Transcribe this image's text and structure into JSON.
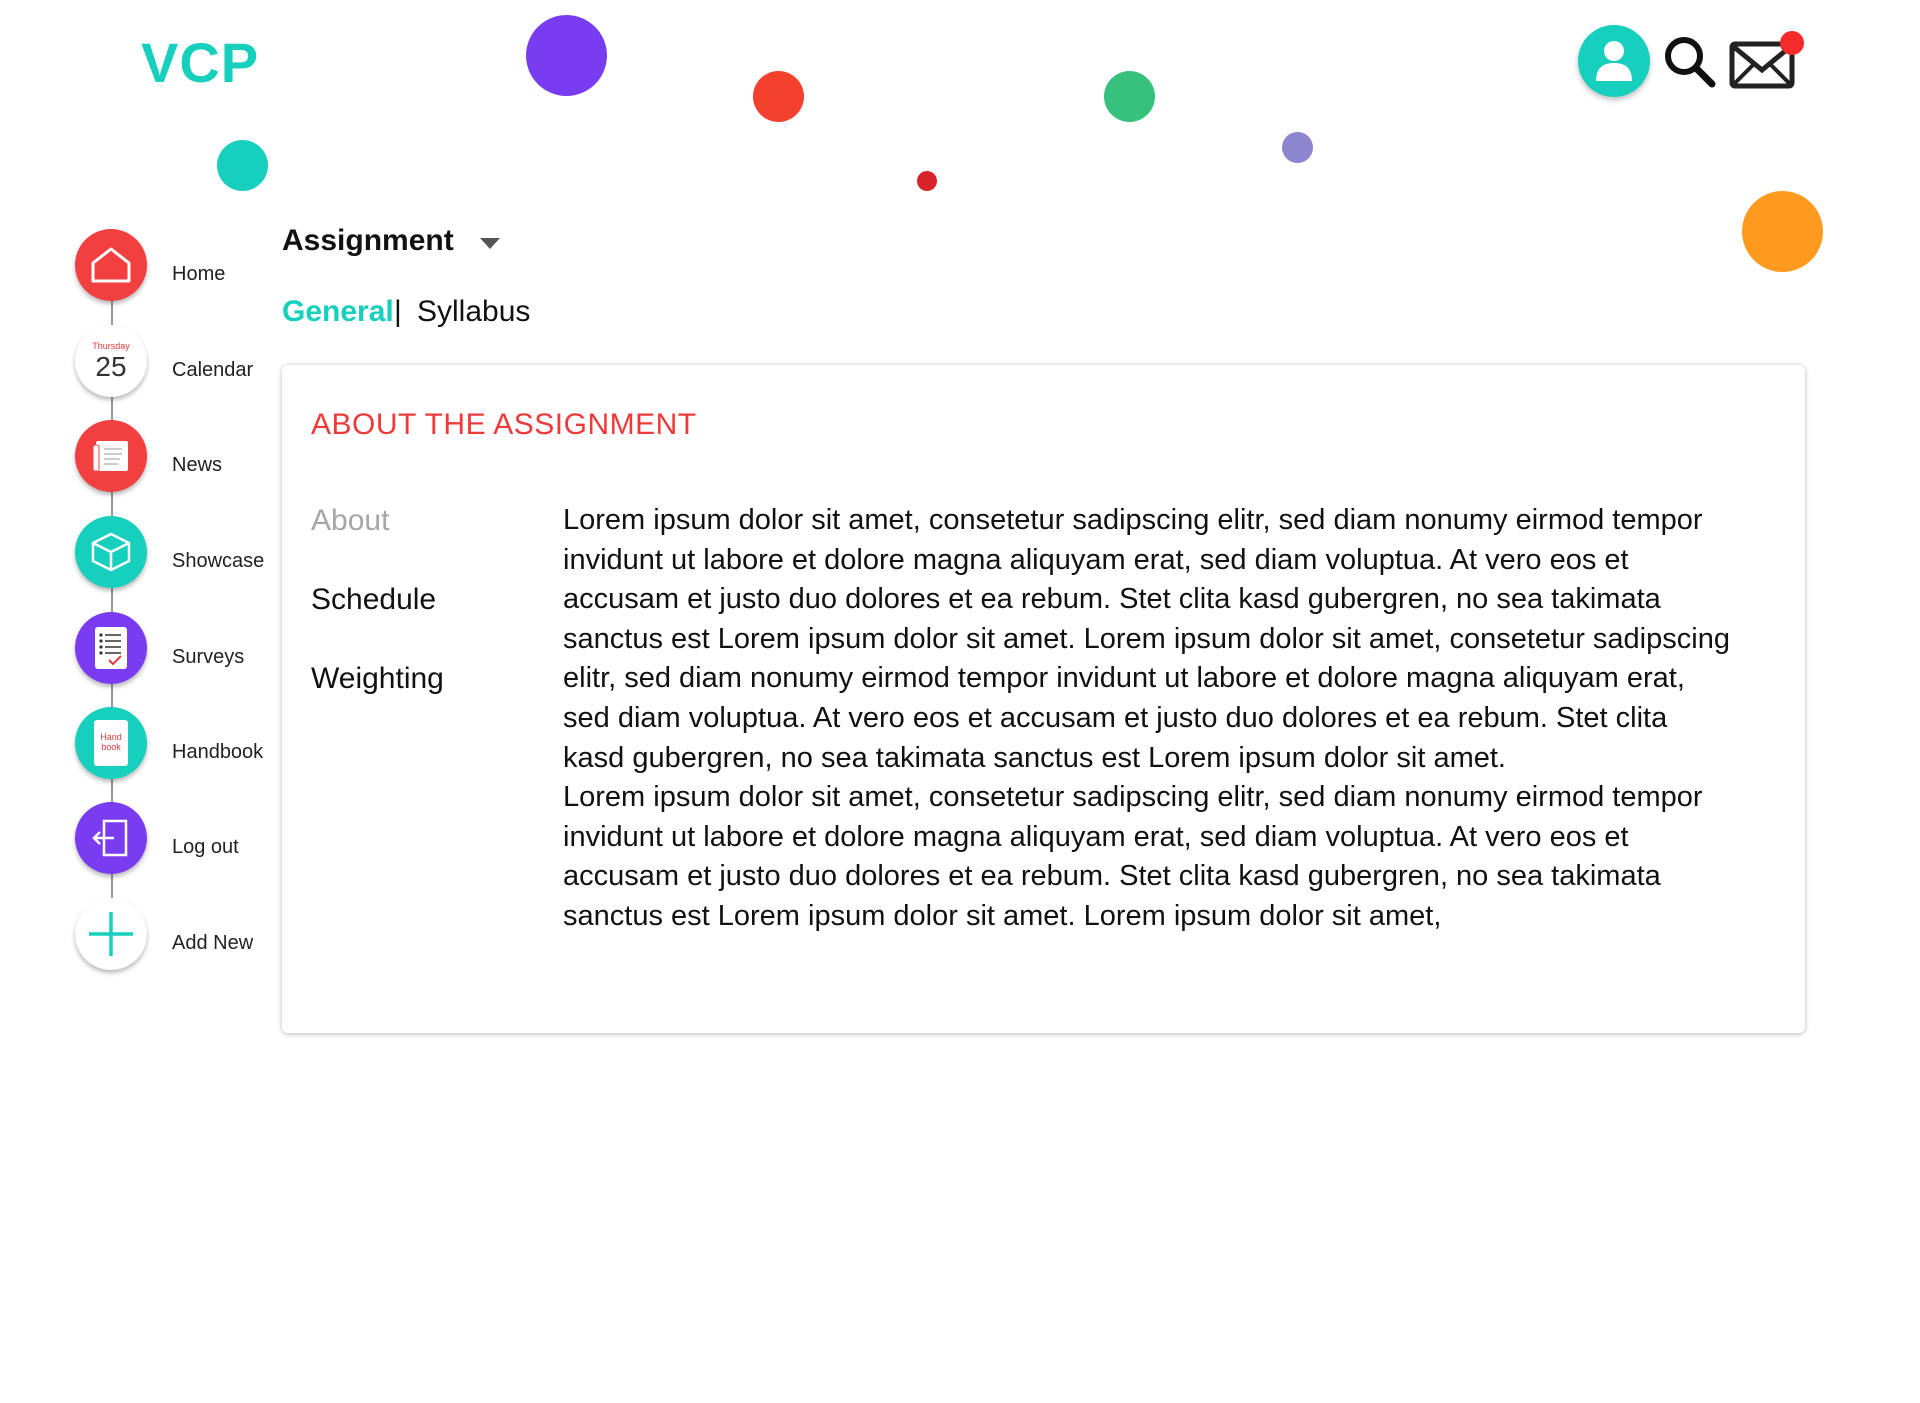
{
  "brand": {
    "logo_text": "VCP"
  },
  "header": {
    "profile_icon": "user-icon",
    "search_icon": "search-icon",
    "mail_icon": "mail-icon",
    "mail_has_notification": true
  },
  "colors": {
    "teal": "#16cfbd",
    "red": "#f24040",
    "purple": "#7a3cf0",
    "orange": "#ff9a1f",
    "green": "#36c17c",
    "lavender": "#8d86cf"
  },
  "sidebar": {
    "items": [
      {
        "label": "Home",
        "icon": "home-icon"
      },
      {
        "label": "Calendar",
        "icon": "calendar-icon",
        "day_name": "Thursday",
        "day_number": "25"
      },
      {
        "label": "News",
        "icon": "news-icon"
      },
      {
        "label": "Showcase",
        "icon": "box-icon"
      },
      {
        "label": "Surveys",
        "icon": "survey-icon"
      },
      {
        "label": "Handbook",
        "icon": "handbook-icon",
        "icon_text_1": "Hand",
        "icon_text_2": "book"
      },
      {
        "label": "Log out",
        "icon": "logout-icon"
      },
      {
        "label": "Add New",
        "icon": "plus-icon"
      }
    ]
  },
  "main": {
    "title": "Assignment",
    "tabs": [
      {
        "label": "General",
        "active": true
      },
      {
        "label": "Syllabus",
        "active": false
      }
    ],
    "tab_separator": "|",
    "card": {
      "title": "ABOUT THE ASSIGNMENT",
      "side_nav": [
        "About",
        "Schedule",
        "Weighting"
      ],
      "paragraphs": [
        "Lorem ipsum dolor sit amet, consetetur sadipscing elitr, sed diam nonumy eirmod tempor invidunt ut labore et dolore magna aliquyam erat, sed diam voluptua. At vero eos et accusam et justo duo dolores et ea rebum. Stet clita kasd gubergren, no sea takimata sanctus est Lorem ipsum dolor sit amet. Lorem ipsum dolor sit amet, consetetur sadipscing elitr, sed diam nonumy eirmod tempor invidunt ut labore et dolore magna aliquyam erat, sed diam voluptua. At vero eos et accusam et justo duo dolores et ea rebum. Stet clita kasd gubergren, no sea takimata sanctus est Lorem ipsum dolor sit amet.",
        "Lorem ipsum dolor sit amet, consetetur sadipscing elitr, sed diam nonumy eirmod tempor invidunt ut labore et dolore magna aliquyam erat, sed diam voluptua. At vero eos et accusam et justo duo dolores et ea rebum. Stet clita kasd gubergren, no sea takimata sanctus est Lorem ipsum dolor sit amet. Lorem ipsum dolor sit amet,"
      ]
    }
  }
}
